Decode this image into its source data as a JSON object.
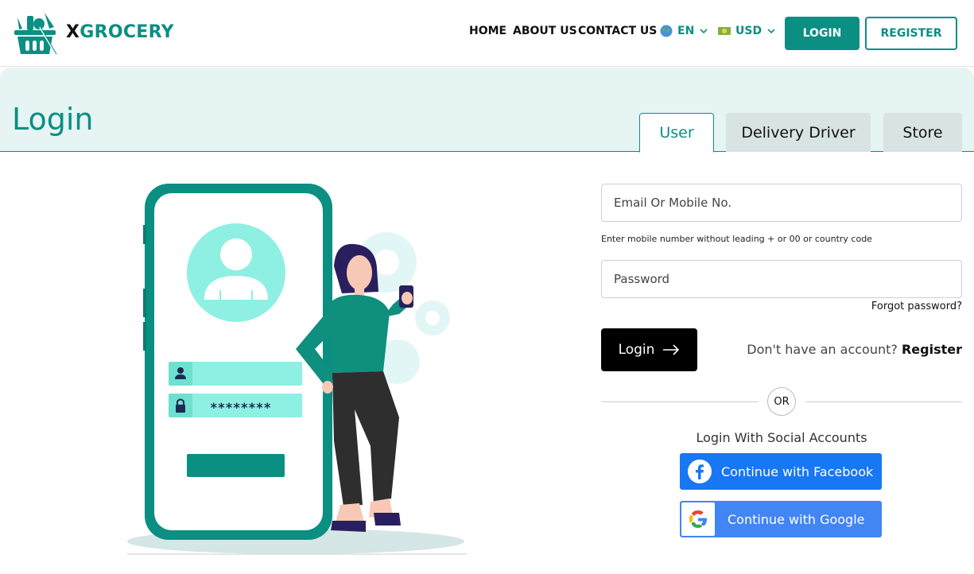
{
  "header": {
    "brand_x": "X",
    "brand_rest": "GROCERY",
    "nav": {
      "home": "HOME",
      "about": "ABOUT US",
      "contact": "CONTACT US"
    },
    "language": "EN",
    "currency": "USD",
    "login_label": "LOGIN",
    "register_label": "REGISTER"
  },
  "banner": {
    "title": "Login",
    "tabs": {
      "user": "User",
      "driver": "Delivery Driver",
      "store": "Store"
    },
    "active_tab": "User"
  },
  "illustration": {
    "password_mask": "********"
  },
  "form": {
    "email_placeholder": "Email Or Mobile No.",
    "email_hint": "Enter mobile number without leading + or 00 or country code",
    "password_placeholder": "Password",
    "forgot_label": "Forgot password?",
    "submit_label": "Login",
    "no_account_text": "Don't have an account?",
    "register_link": "Register",
    "or_text": "OR",
    "social_label": "Login With Social Accounts",
    "facebook_label": "Continue with Facebook",
    "google_label": "Continue with Google"
  },
  "colors": {
    "brand": "#0a8f82",
    "banner_bg": "#e6f4f4",
    "facebook": "#1877f2",
    "google": "#4285f4",
    "submit_bg": "#000000"
  }
}
